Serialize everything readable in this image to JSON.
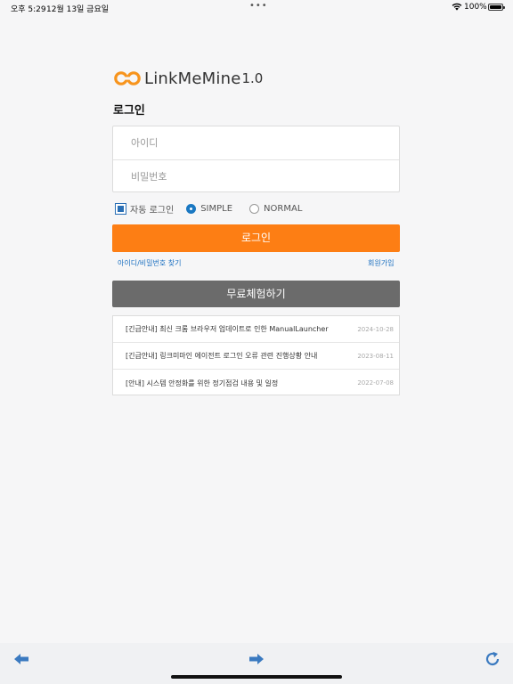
{
  "status_bar": {
    "time": "오후 5:29",
    "date": "12월 13일 금요일",
    "dots": "•••",
    "battery_percent": "100%",
    "battery_level": 1.0
  },
  "logo": {
    "name": "LinkMeMine",
    "version": "1.0",
    "icon": "linkmemine-logo-icon"
  },
  "title": "로그인",
  "form": {
    "id_placeholder": "아이디",
    "password_placeholder": "비밀번호",
    "auto_login_label": "자동 로그인",
    "auto_login_checked": true,
    "mode_options": [
      "SIMPLE",
      "NORMAL"
    ],
    "mode_selected": "SIMPLE",
    "login_button": "로그인",
    "find_account_link": "아이디/비밀번호 찾기",
    "signup_link": "회원가입"
  },
  "trial_button": "무료체험하기",
  "notices": [
    {
      "title": "[긴급안내] 최신 크롬 브라우저 업데이트로 인한 ManualLauncher",
      "date": "2024-10-28"
    },
    {
      "title": "[긴급안내] 링크미마인 에이전트 로그인 오류 관련 진행상황 안내",
      "date": "2023-08-11"
    },
    {
      "title": "[안내] 시스템 안정화를 위한 정기점검 내용 및 일정",
      "date": "2022-07-08"
    }
  ],
  "toolbar": {
    "back_icon": "arrow-left-icon",
    "forward_icon": "arrow-right-icon",
    "refresh_icon": "refresh-icon"
  },
  "colors": {
    "accent": "#fd7e14",
    "trial": "#6b6b6b",
    "link": "#1a6fc0",
    "toolbar_icon": "#3b7ac0"
  }
}
